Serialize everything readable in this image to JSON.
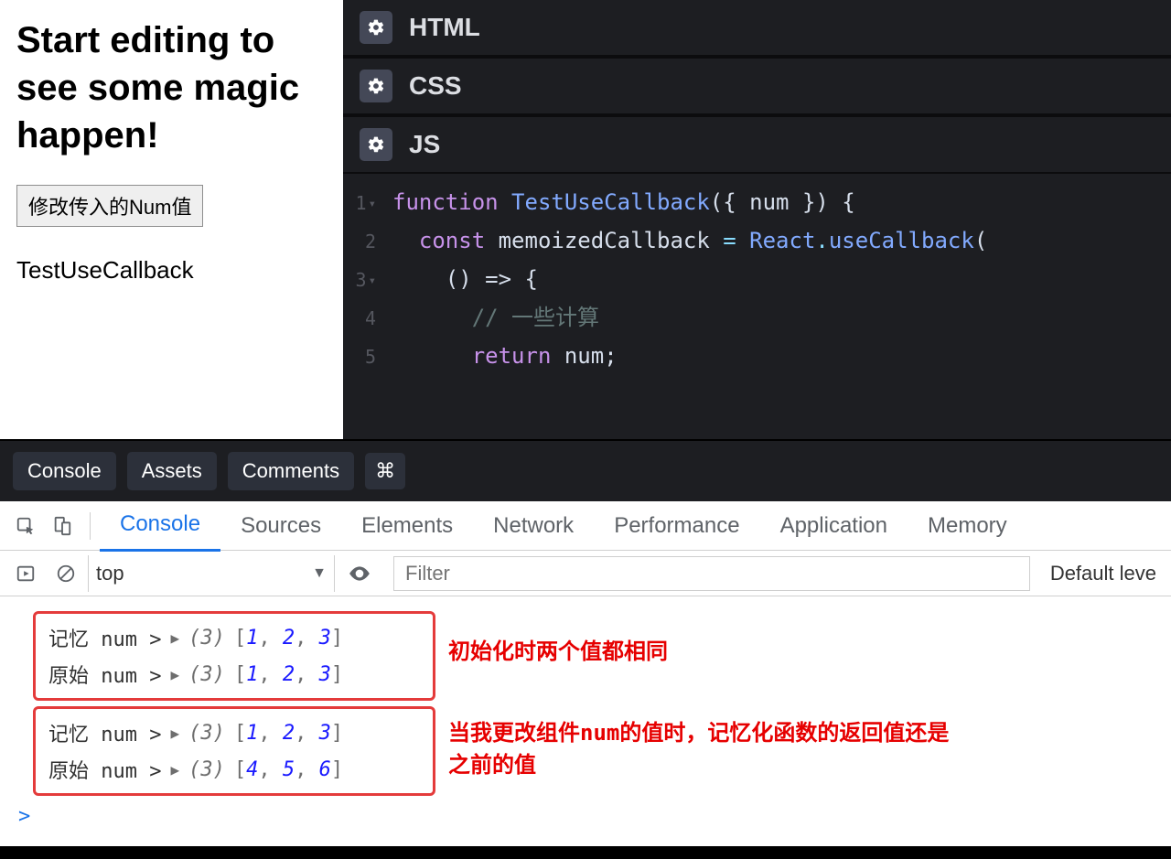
{
  "preview": {
    "heading": "Start editing to see some magic happen!",
    "button_label": "修改传入的Num值",
    "subtext": "TestUseCallback"
  },
  "editor_sections": {
    "html_label": "HTML",
    "css_label": "CSS",
    "js_label": "JS"
  },
  "code": {
    "l1_kw": "function ",
    "l1_name": "TestUseCallback",
    "l1_after": "({ num }) {",
    "l2_kw": "const",
    "l2_var": " memoizedCallback ",
    "l2_eq": "= ",
    "l2_obj": "React",
    "l2_dot": ".",
    "l2_method": "useCallback",
    "l2_paren": "(",
    "l3": "() => {",
    "l4": "// 一些计算",
    "l5_kw": "return",
    "l5_rest": " num;"
  },
  "line_numbers": {
    "l1": "1",
    "l2": "2",
    "l3": "3",
    "l4": "4",
    "l5": "5"
  },
  "bottom_tabs": {
    "console": "Console",
    "assets": "Assets",
    "comments": "Comments",
    "shortcut": "⌘"
  },
  "devtools_tabs": {
    "console": "Console",
    "sources": "Sources",
    "elements": "Elements",
    "network": "Network",
    "performance": "Performance",
    "application": "Application",
    "memory": "Memory"
  },
  "devtools_toolbar": {
    "context": "top",
    "context_arrow": "▼",
    "filter_placeholder": "Filter",
    "level_label": "Default leve"
  },
  "console_logs": {
    "group1": {
      "row1": {
        "label": "记忆 num >",
        "length": "(3)",
        "values": [
          1,
          2,
          3
        ]
      },
      "row2": {
        "label": "原始 num >",
        "length": "(3)",
        "values": [
          1,
          2,
          3
        ]
      }
    },
    "group2": {
      "row1": {
        "label": "记忆 num >",
        "length": "(3)",
        "values": [
          1,
          2,
          3
        ]
      },
      "row2": {
        "label": "原始 num >",
        "length": "(3)",
        "values": [
          4,
          5,
          6
        ]
      }
    }
  },
  "annotations": {
    "a1": "初始化时两个值都相同",
    "a2": "当我更改组件num的值时，记忆化函数的返回值还是之前的值"
  },
  "prompt": ">"
}
